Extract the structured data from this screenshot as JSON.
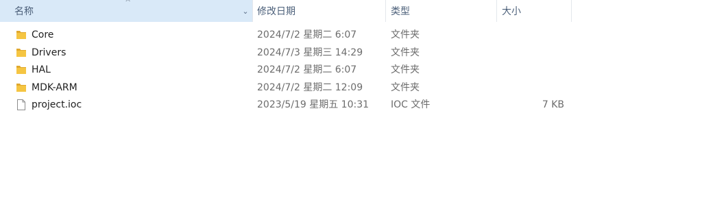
{
  "columns": {
    "name": "名称",
    "date": "修改日期",
    "type": "类型",
    "size": "大小"
  },
  "sort_indicator": "^",
  "dropdown_icon": "chevron-down-icon",
  "files": [
    {
      "name": "Core",
      "date": "2024/7/2 星期二 6:07",
      "type": "文件夹",
      "size": "",
      "icon": "folder-icon"
    },
    {
      "name": "Drivers",
      "date": "2024/7/3 星期三 14:29",
      "type": "文件夹",
      "size": "",
      "icon": "folder-icon"
    },
    {
      "name": "HAL",
      "date": "2024/7/2 星期二 6:07",
      "type": "文件夹",
      "size": "",
      "icon": "folder-icon"
    },
    {
      "name": "MDK-ARM",
      "date": "2024/7/2 星期二 12:09",
      "type": "文件夹",
      "size": "",
      "icon": "folder-icon"
    },
    {
      "name": "project.ioc",
      "date": "2023/5/19 星期五 10:31",
      "type": "IOC 文件",
      "size": "7 KB",
      "icon": "file-icon"
    }
  ],
  "colors": {
    "header_selected_bg": "#d9e9f8",
    "header_text": "#4c607a",
    "folder_yellow": "#f5c542",
    "folder_dark": "#e0a82e"
  }
}
